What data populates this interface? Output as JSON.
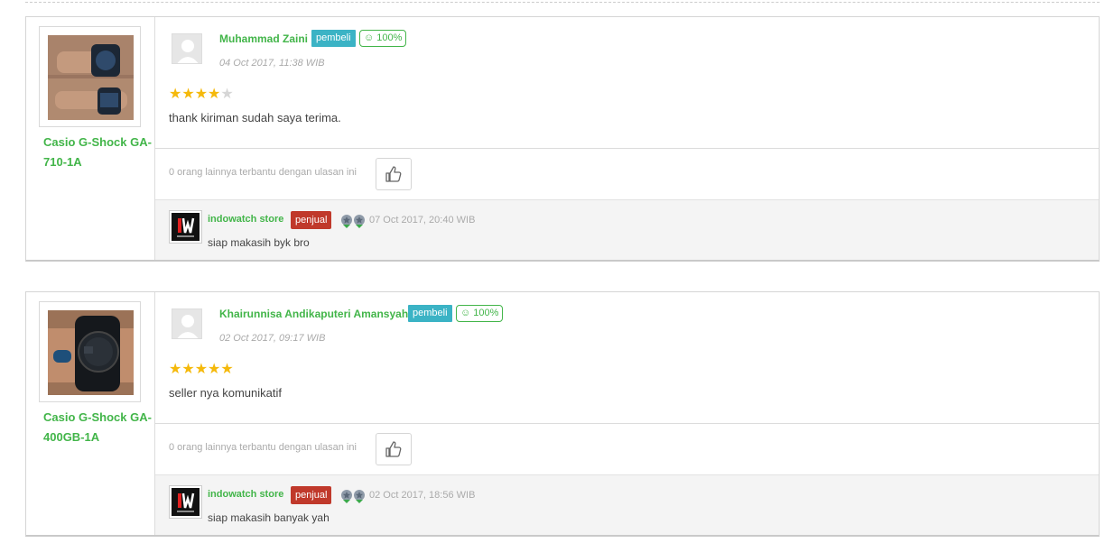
{
  "reviews": [
    {
      "product": {
        "name": "Casio G-Shock GA-710-1A"
      },
      "reviewer": {
        "name": "Muhammad Zaini",
        "role": "pembeli",
        "reputation": "100%"
      },
      "date": "04 Oct 2017, 11:38 WIB",
      "rating": 4,
      "rating_max": 5,
      "text": "thank kiriman sudah saya terima.",
      "helpful_text": "0 orang lainnya terbantu dengan ulasan ini",
      "reply": {
        "store": "indowatch store",
        "role": "penjual",
        "date": "07 Oct 2017, 20:40 WIB",
        "text": "siap makasih byk bro"
      }
    },
    {
      "product": {
        "name": "Casio G-Shock GA-400GB-1A"
      },
      "reviewer": {
        "name": "Khairunnisa Andikaputeri Amansyah",
        "role": "pembeli",
        "reputation": "100%"
      },
      "date": "02 Oct 2017, 09:17 WIB",
      "rating": 5,
      "rating_max": 5,
      "text": "seller nya komunikatif",
      "helpful_text": "0 orang lainnya terbantu dengan ulasan ini",
      "reply": {
        "store": "indowatch store",
        "role": "penjual",
        "date": "02 Oct 2017, 18:56 WIB",
        "text": "siap makasih banyak yah"
      }
    }
  ],
  "colors": {
    "accent_green": "#42b549",
    "buyer_badge": "#3bb3c5",
    "seller_badge": "#c0392b",
    "star": "#f5b90b"
  },
  "icons": {
    "like": "thumbs-up-icon",
    "reputation": "smiley-icon",
    "medal": "medal-icon"
  }
}
